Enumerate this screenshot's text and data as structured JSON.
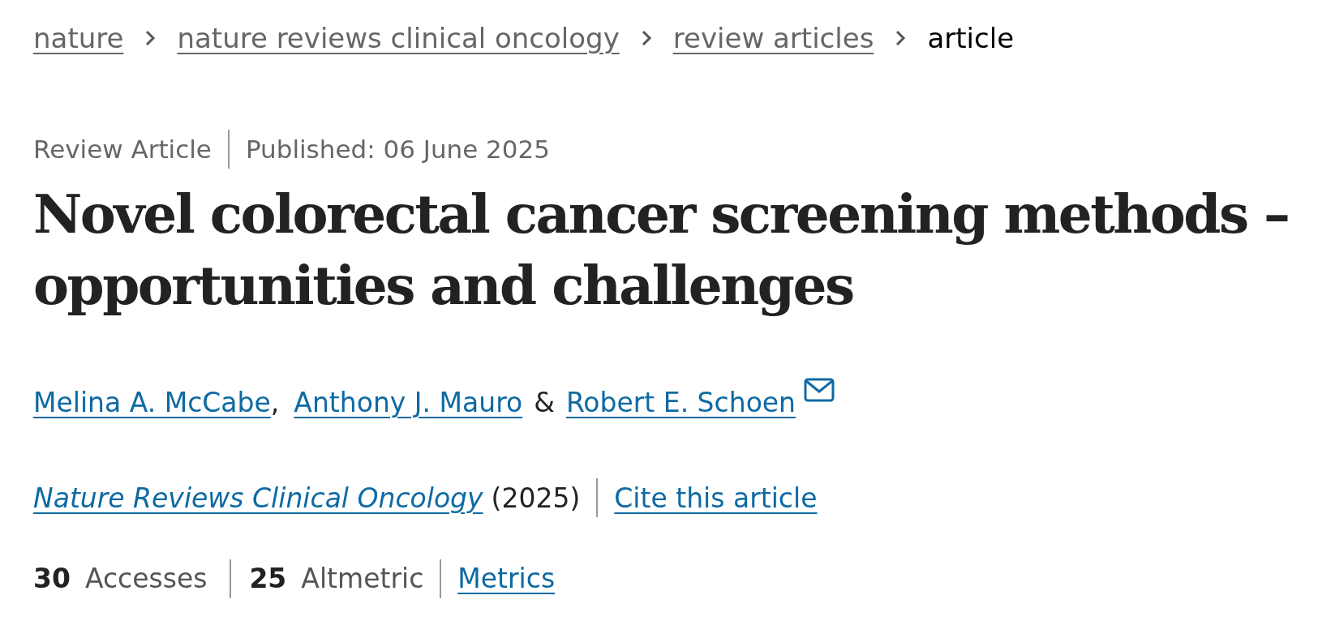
{
  "breadcrumbs": [
    {
      "label": "nature",
      "kind": "link"
    },
    {
      "label": "nature reviews clinical oncology",
      "kind": "link"
    },
    {
      "label": "review articles",
      "kind": "link"
    },
    {
      "label": "article",
      "kind": "current"
    }
  ],
  "meta": {
    "article_type": "Review Article",
    "published": "Published: 06 June 2025"
  },
  "title": "Novel colorectal cancer screening methods – opportunities and challenges",
  "authors": [
    {
      "name": "Melina A. McCabe",
      "separator_after": ",",
      "corresponding": false
    },
    {
      "name": "Anthony J. Mauro",
      "separator_after": "&",
      "corresponding": false
    },
    {
      "name": "Robert E. Schoen",
      "corresponding": true
    }
  ],
  "citation": {
    "journal": "Nature Reviews Clinical Oncology",
    "year": "(2025)",
    "cite_link": "Cite this article"
  },
  "metrics": [
    {
      "count": "30",
      "name": "Accesses"
    },
    {
      "count": "25",
      "name": "Altmetric"
    }
  ],
  "metrics_link": "Metrics"
}
